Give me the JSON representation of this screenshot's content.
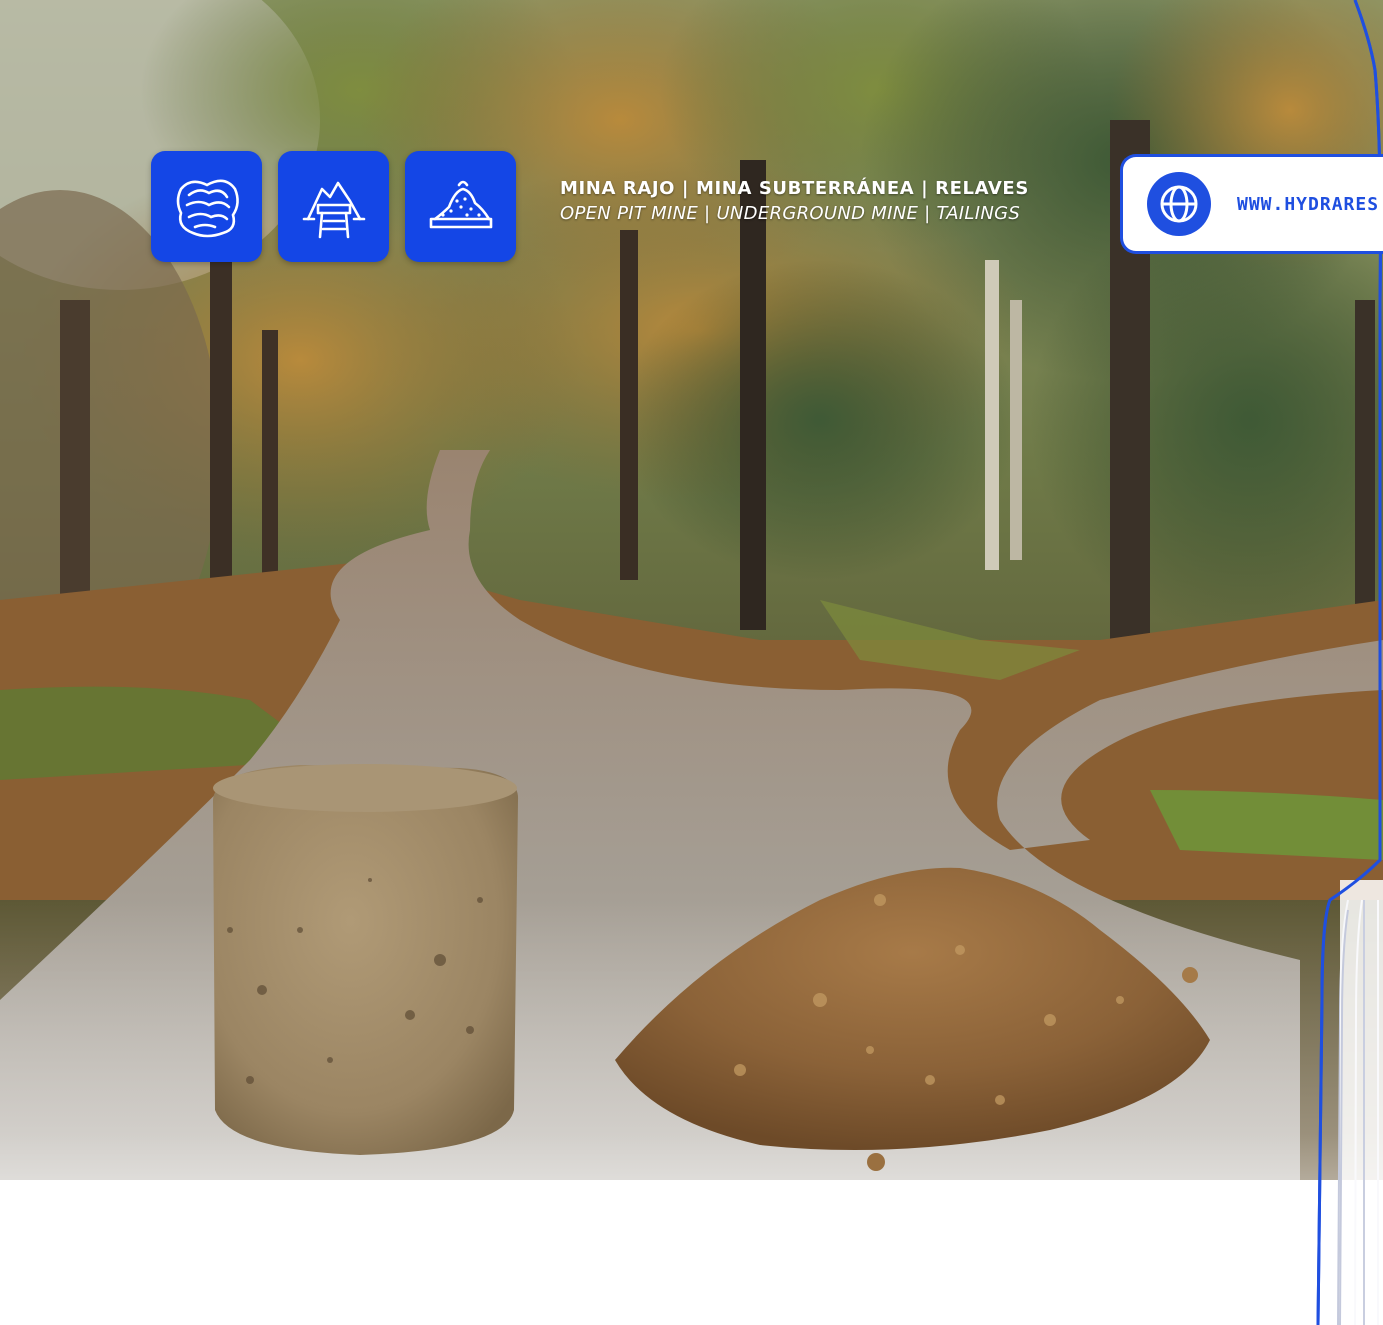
{
  "brand": {
    "accent": "#1f4fe0",
    "tile_color": "#1446e6",
    "text_color": "#ffffff"
  },
  "icons": [
    {
      "name": "open-pit-mine-icon"
    },
    {
      "name": "underground-mine-icon"
    },
    {
      "name": "tailings-icon"
    }
  ],
  "headline": {
    "spanish": "MINA RAJO | MINA SUBTERRÁNEA | RELAVES",
    "english": "OPEN PIT MINE | UNDERGROUND MINE | TAILINGS"
  },
  "website": {
    "icon": "globe-icon",
    "url": "WWW.HYDRARES"
  }
}
